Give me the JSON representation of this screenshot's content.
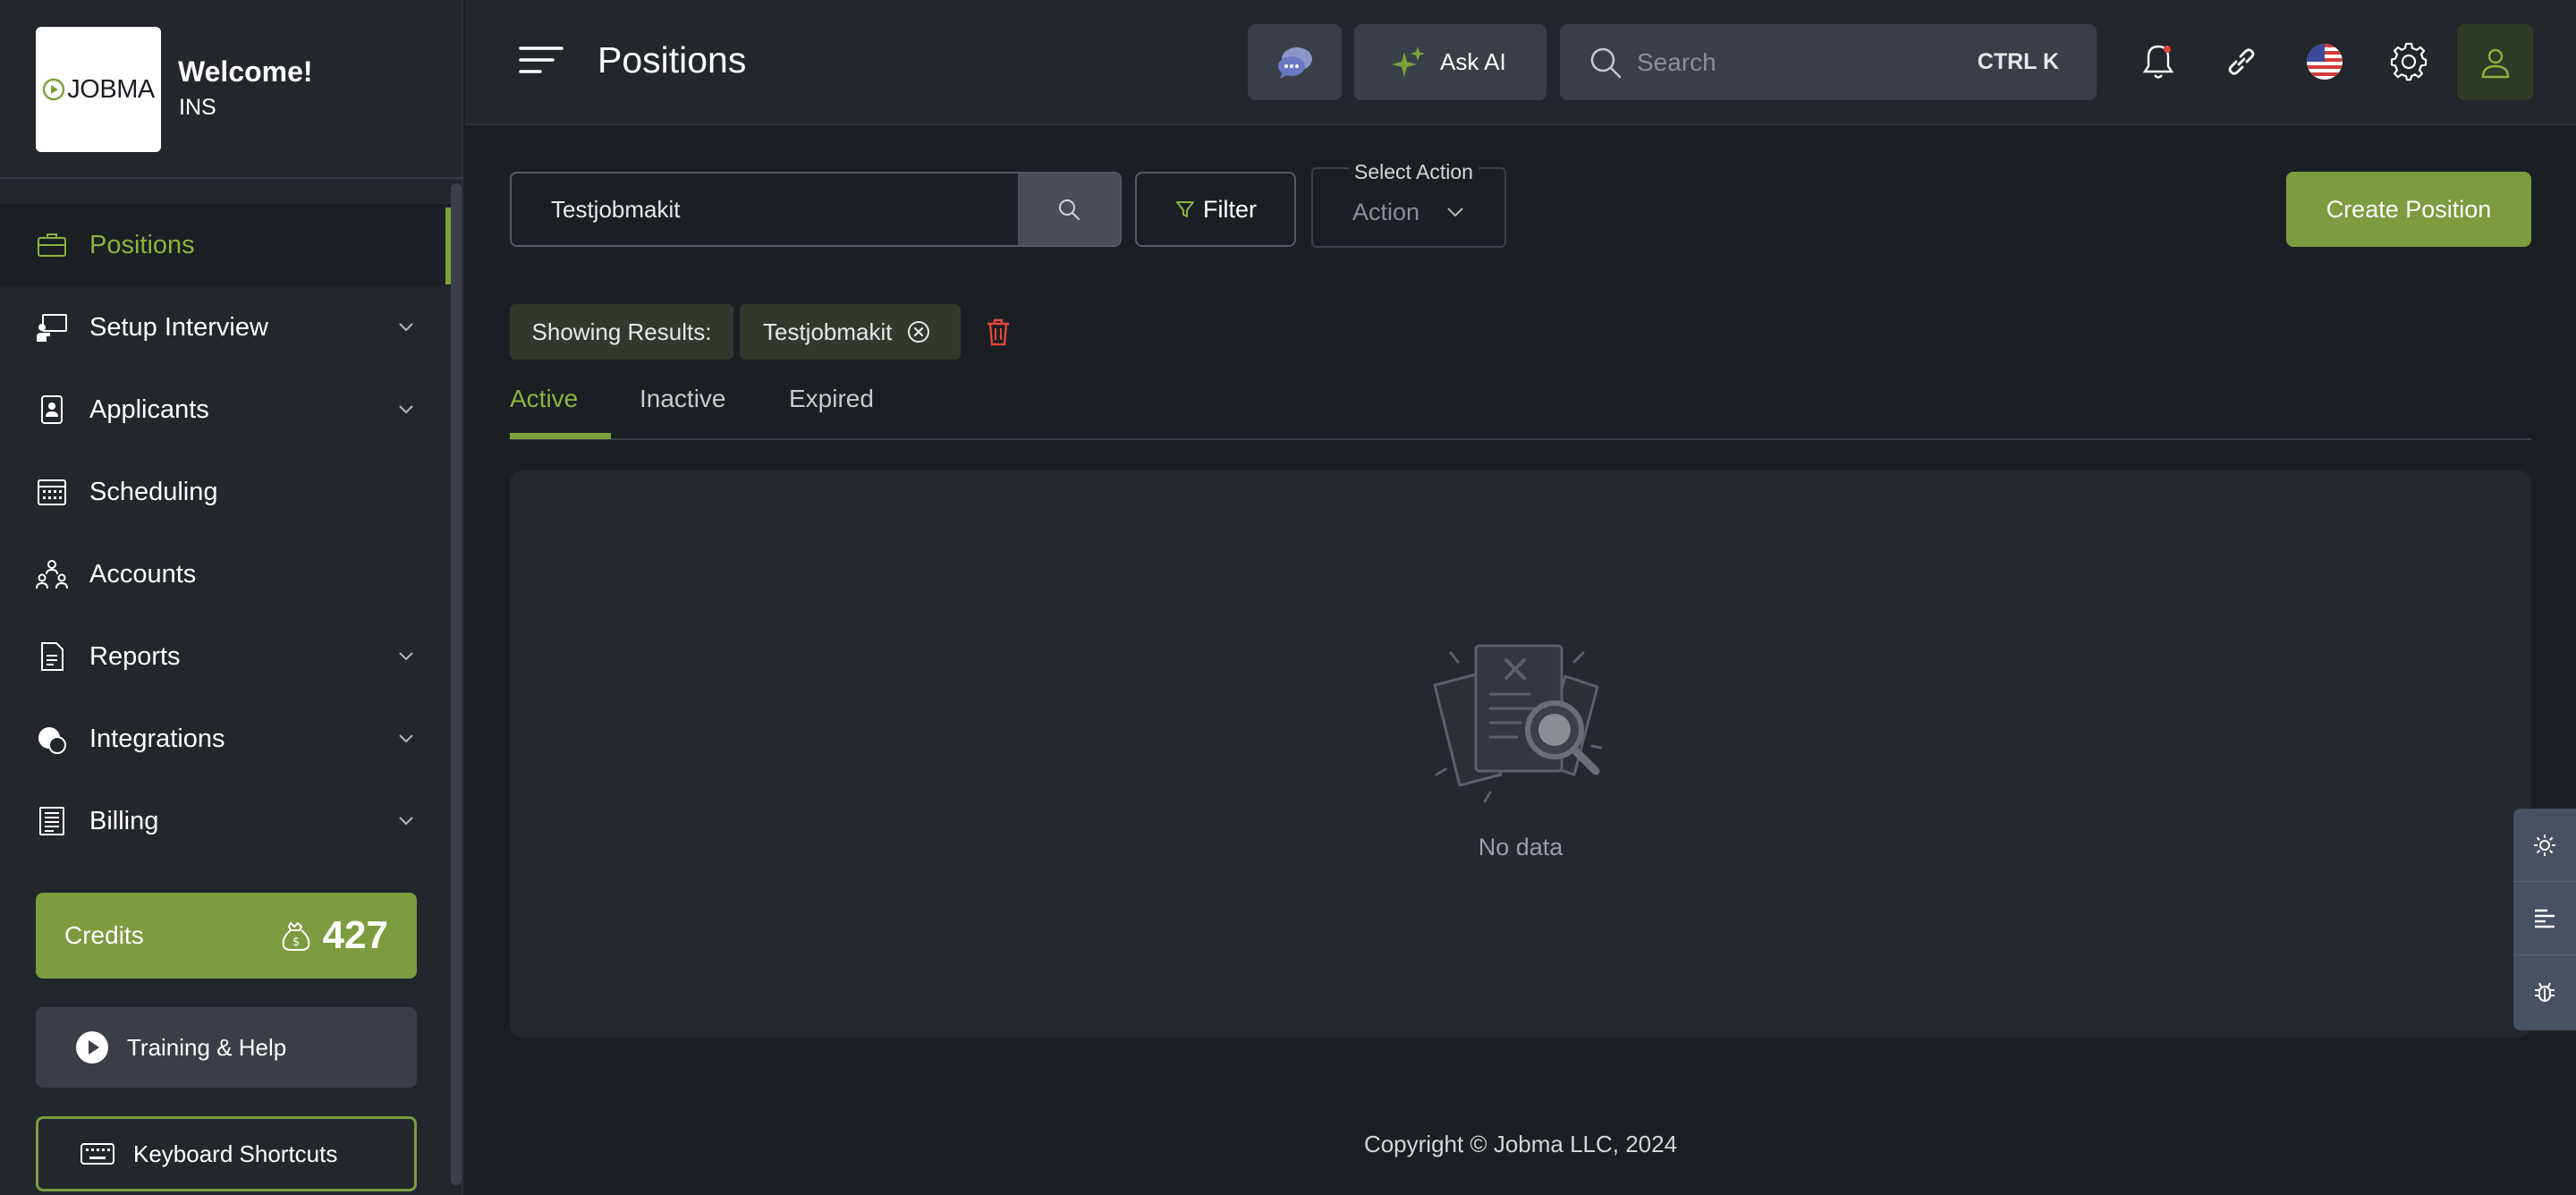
{
  "brand": {
    "logo_text": "JOBMA",
    "welcome": "Welcome!",
    "org": "INS"
  },
  "nav": [
    {
      "label": "Positions",
      "icon": "briefcase-icon",
      "active": true,
      "expandable": false
    },
    {
      "label": "Setup Interview",
      "icon": "presentation-icon",
      "active": false,
      "expandable": true
    },
    {
      "label": "Applicants",
      "icon": "id-badge-icon",
      "active": false,
      "expandable": true
    },
    {
      "label": "Scheduling",
      "icon": "calendar-icon",
      "active": false,
      "expandable": false
    },
    {
      "label": "Accounts",
      "icon": "users-icon",
      "active": false,
      "expandable": false
    },
    {
      "label": "Reports",
      "icon": "report-icon",
      "active": false,
      "expandable": true
    },
    {
      "label": "Integrations",
      "icon": "integrations-icon",
      "active": false,
      "expandable": true
    },
    {
      "label": "Billing",
      "icon": "billing-icon",
      "active": false,
      "expandable": true
    }
  ],
  "credits": {
    "label": "Credits",
    "value": "427"
  },
  "training": {
    "label": "Training & Help"
  },
  "shortcuts": {
    "label": "Keyboard Shortcuts"
  },
  "header": {
    "title": "Positions",
    "ask_ai": "Ask AI",
    "search_placeholder": "Search",
    "search_shortcut": "CTRL K"
  },
  "toolbar": {
    "search_value": "Testjobmakit",
    "filter_label": "Filter",
    "action_caption": "Select Action",
    "action_value": "Action",
    "create_label": "Create Position"
  },
  "results": {
    "label": "Showing Results:",
    "term": "Testjobmakit"
  },
  "tabs": [
    {
      "label": "Active",
      "active": true
    },
    {
      "label": "Inactive",
      "active": false
    },
    {
      "label": "Expired",
      "active": false
    }
  ],
  "empty": {
    "text": "No data"
  },
  "footer": {
    "copyright": "Copyright © Jobma LLC, 2024"
  },
  "colors": {
    "accent": "#7b9c3f",
    "accent_text": "#8cb33f",
    "background": "#1b1e22",
    "panel": "#25282d",
    "danger": "#e0463c"
  }
}
